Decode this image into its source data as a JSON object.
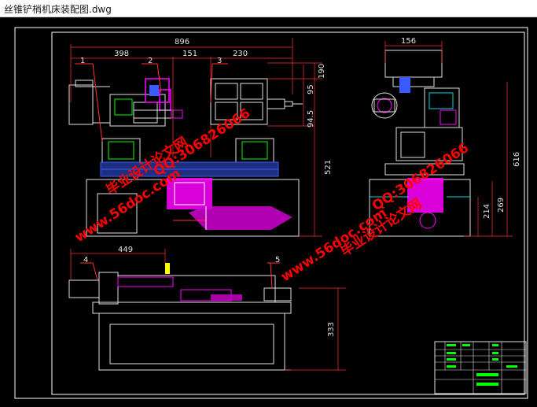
{
  "window": {
    "title": "丝锥铲梢机床装配图.dwg"
  },
  "drawing": {
    "dimensions": {
      "overall_width": "896",
      "seg_left": "398",
      "seg_mid": "151",
      "seg_right": "230",
      "side_width": "156",
      "bottom_width": "449",
      "h_95": "95",
      "h_190": "190",
      "h_94_5": "94.5",
      "h_521": "521",
      "h_616": "616",
      "h_269": "269",
      "h_214": "214",
      "h_333": "333"
    },
    "callouts": [
      "1",
      "2",
      "3",
      "4",
      "5"
    ],
    "watermarks": {
      "site": "www.56doc.com",
      "qq": "QQ:306826066",
      "brand": "毕业设计论文网"
    },
    "colors": {
      "background": "#000000",
      "frame": "#ffffff",
      "dimension": "#ff3030",
      "part": "#e0e0e0",
      "accent": "#ff00ff",
      "blue": "#3a5bff",
      "green": "#00ff00",
      "cyan": "#00d8d8",
      "yellow": "#ffff00",
      "watermark": "#ff0000"
    }
  }
}
